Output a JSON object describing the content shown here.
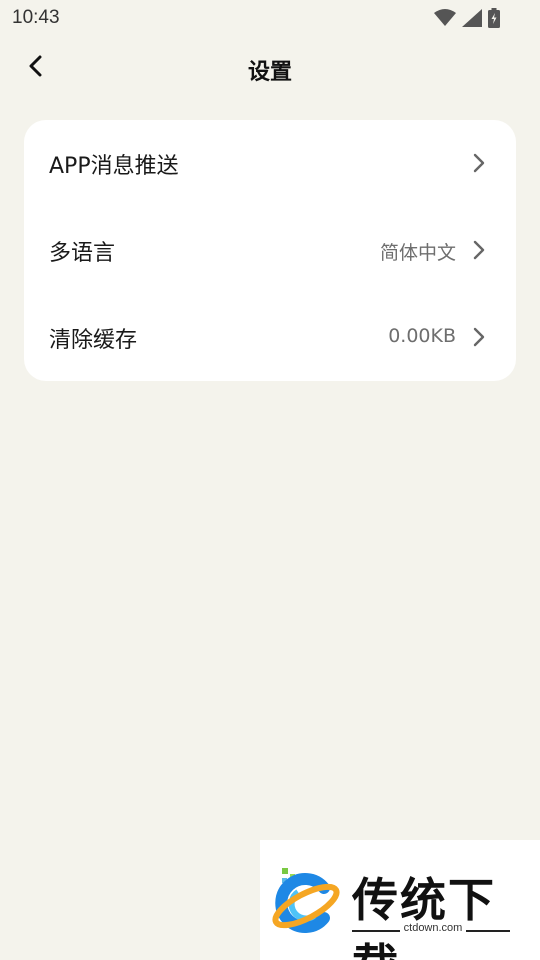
{
  "status_bar": {
    "time": "10:43"
  },
  "header": {
    "title": "设置"
  },
  "settings": {
    "items": [
      {
        "label": "APP消息推送",
        "value": ""
      },
      {
        "label": "多语言",
        "value": "简体中文"
      },
      {
        "label": "清除缓存",
        "value": "0.00KB"
      }
    ]
  },
  "watermark": {
    "brand": "传统下载",
    "url": "ctdown.com"
  },
  "colors": {
    "background": "#f4f3ec",
    "card": "#ffffff",
    "text_primary": "#1a1a1a",
    "text_secondary": "#6e6e6e"
  }
}
